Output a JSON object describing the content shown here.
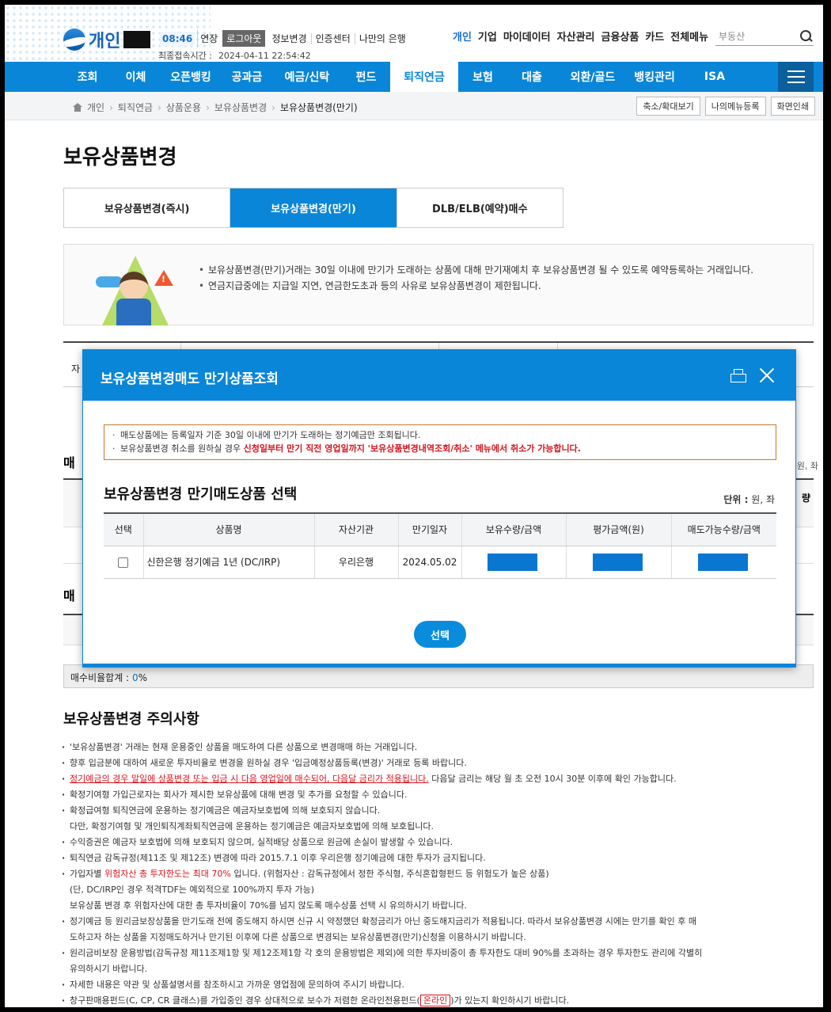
{
  "header": {
    "logo_text": "개인",
    "timer": "08:46",
    "extend": "연장",
    "logout": "로그아웃",
    "utils": [
      "정보변경",
      "인증센터",
      "나만의 은행"
    ],
    "last_login_label": "최종접속시간 :",
    "last_login_value": "2024-04-11 22:54:42",
    "segments": [
      "개인",
      "기업",
      "마이데이터",
      "자산관리",
      "금융상품",
      "카드",
      "전체메뉴"
    ],
    "search_placeholder": "부동산"
  },
  "gnb": [
    "조회",
    "이체",
    "오픈뱅킹",
    "공과금",
    "예금/신탁",
    "펀드",
    "퇴직연금",
    "보험",
    "대출",
    "외환/골드",
    "뱅킹관리",
    "ISA"
  ],
  "gnb_active": "퇴직연금",
  "breadcrumb": [
    "개인",
    "퇴직연금",
    "상품운용",
    "보유상품변경",
    "보유상품변경(만기)"
  ],
  "crumb_buttons": [
    "축소/확대보기",
    "나의메뉴등록",
    "화면인쇄"
  ],
  "page_title": "보유상품변경",
  "tabs": [
    "보유상품변경(즉시)",
    "보유상품변경(만기)",
    "DLB/ELB(예약)매수"
  ],
  "info": [
    "보유상품변경(만기)거래는 30일 이내에 만기가 도래하는 상품에 대해 만기재예치 후 보유상품변경 될 수 있도록 예약등록하는 거래입니다.",
    "연금지급중에는 지급일 지연, 연금한도초과 등의 사유로 보유상품변경이 제한됩니다."
  ],
  "background": {
    "first_label": "자",
    "section_a": "매",
    "unit_a": "원, 좌",
    "col_right": "량",
    "section_b": "매",
    "sum_label": "매수비율합계 :",
    "sum_value": "0",
    "sum_unit": "%"
  },
  "notice_title": "보유상품변경 주의사항",
  "notices": {
    "l1": "'보유상품변경' 거래는 현재 운용중인 상품을 매도하여 다른 상품으로 변경매매 하는 거래입니다.",
    "l2": "향후 입금분에 대하여 새로운 투자비율로 변경을 원하실 경우 '입금예정상품등록(변경)' 거래로 등록 바랍니다.",
    "l3_red": "정기예금의 경우 말일에 상품변경 또는 입금 시 다음 영업일에 매수되어, 다음달 금리가 적용됩니다.",
    "l3_rest": " 다음달 금리는 해당 월 초 오전 10시 30분 이후에 확인 가능합니다.",
    "l4": "확정기여형 가입근로자는 회사가 제시한 보유상품에 대해 변경 및 추가를 요청할 수 있습니다.",
    "l5": "확정급여형 퇴직연금에 운용하는 정기예금은 예금자보호법에 의해 보호되지 않습니다.",
    "l5b": "다만, 확정기여형 및 개인퇴직계좌퇴직연금에 운용하는 정기예금은 예금자보호법에 의해 보호됩니다.",
    "l6": "수익증권은 예금자 보호법에 의해 보호되지 않으며, 실적배당 상품으로 원금에 손실이 발생할 수 있습니다.",
    "l7": "퇴직연금 감독규정(제11조 및 제12조) 변경에 따라 2015.7.1 이후 우리은행 정기예금에 대한 투자가 금지됩니다.",
    "l8_pre": "가입자별 ",
    "l8_red": "위험자산 총 투자한도는 최대 70%",
    "l8_rest": " 입니다. (위험자산 : 감독규정에서 정한 주식형, 주식혼합형펀드 등 위험도가 높은 상품)",
    "l8b": "(단, DC/IRP인 경우 적격TDF는 예외적으로 100%까지 투자 가능)",
    "l8c": "보유상품 변경 후 위험자산에 대한 총 투자비율이 70%를 넘지 않도록 매수상품 선택 시 유의하시기 바랍니다.",
    "l9": "정기예금 등 원리금보장상품을 만기도래 전에 중도해지 하시면 신규 시 약정했던 확정금리가 아닌 중도해지금리가 적용됩니다. 따라서 보유상품변경 시에는 만기를 확인 후 매",
    "l9b": "도하고자 하는 상품을 지정매도하거나 만기된 이후에 다른 상품으로 변경되는 보유상품변경(만기)신청을 이용하시기 바랍니다.",
    "l10": "원리금비보장 운용방법(감독규정 제11조제1항 및 제12조제1항 각 호의 운용방법은 제외)에 의한 투자비중이 총 투자한도 대비 90%를 초과하는 경우 투자한도 관리에 각별히",
    "l10b": "유의하시기 바랍니다.",
    "l11": "자세한 내용은 약관 및 상품설명서를 참조하시고 가까운 영업점에 문의하여 주시기 바랍니다.",
    "l12_pre": "창구판매용펀드(C, CP, CR 클래스)를 가입중인 경우 상대적으로 보수가 저렴한 온라인전용펀드(",
    "l12_box": "온라인",
    "l12_rest": ")가 있는지 확인하시기 바랍니다."
  },
  "modal": {
    "title": "보유상품변경매도 만기상품조회",
    "notice1": "매도상품에는 등록일자 기준 30일 이내에 만기가 도래하는 정기예금만 조회됩니다.",
    "notice2_pre": "보유상품변경 취소를 원하실 경우 ",
    "notice2_red": "신청일부터 만기 직전 영업일까지 '보유상품변경내역조회/취소' 메뉴에서 취소가 가능합니다.",
    "heading": "보유상품변경 만기매도상품 선택",
    "unit_label": "단위 :",
    "unit_value": "원, 좌",
    "columns": [
      "선택",
      "상품명",
      "자산기관",
      "만기일자",
      "보유수량/금액",
      "평가금액(원)",
      "매도가능수량/금액"
    ],
    "row": {
      "product": "신한은행 정기예금 1년 (DC/IRP)",
      "institution": "우리은행",
      "maturity": "2024.05.02"
    },
    "select_button": "선택"
  },
  "colors": {
    "primary": "#0a86d8",
    "red": "#d8141d"
  }
}
